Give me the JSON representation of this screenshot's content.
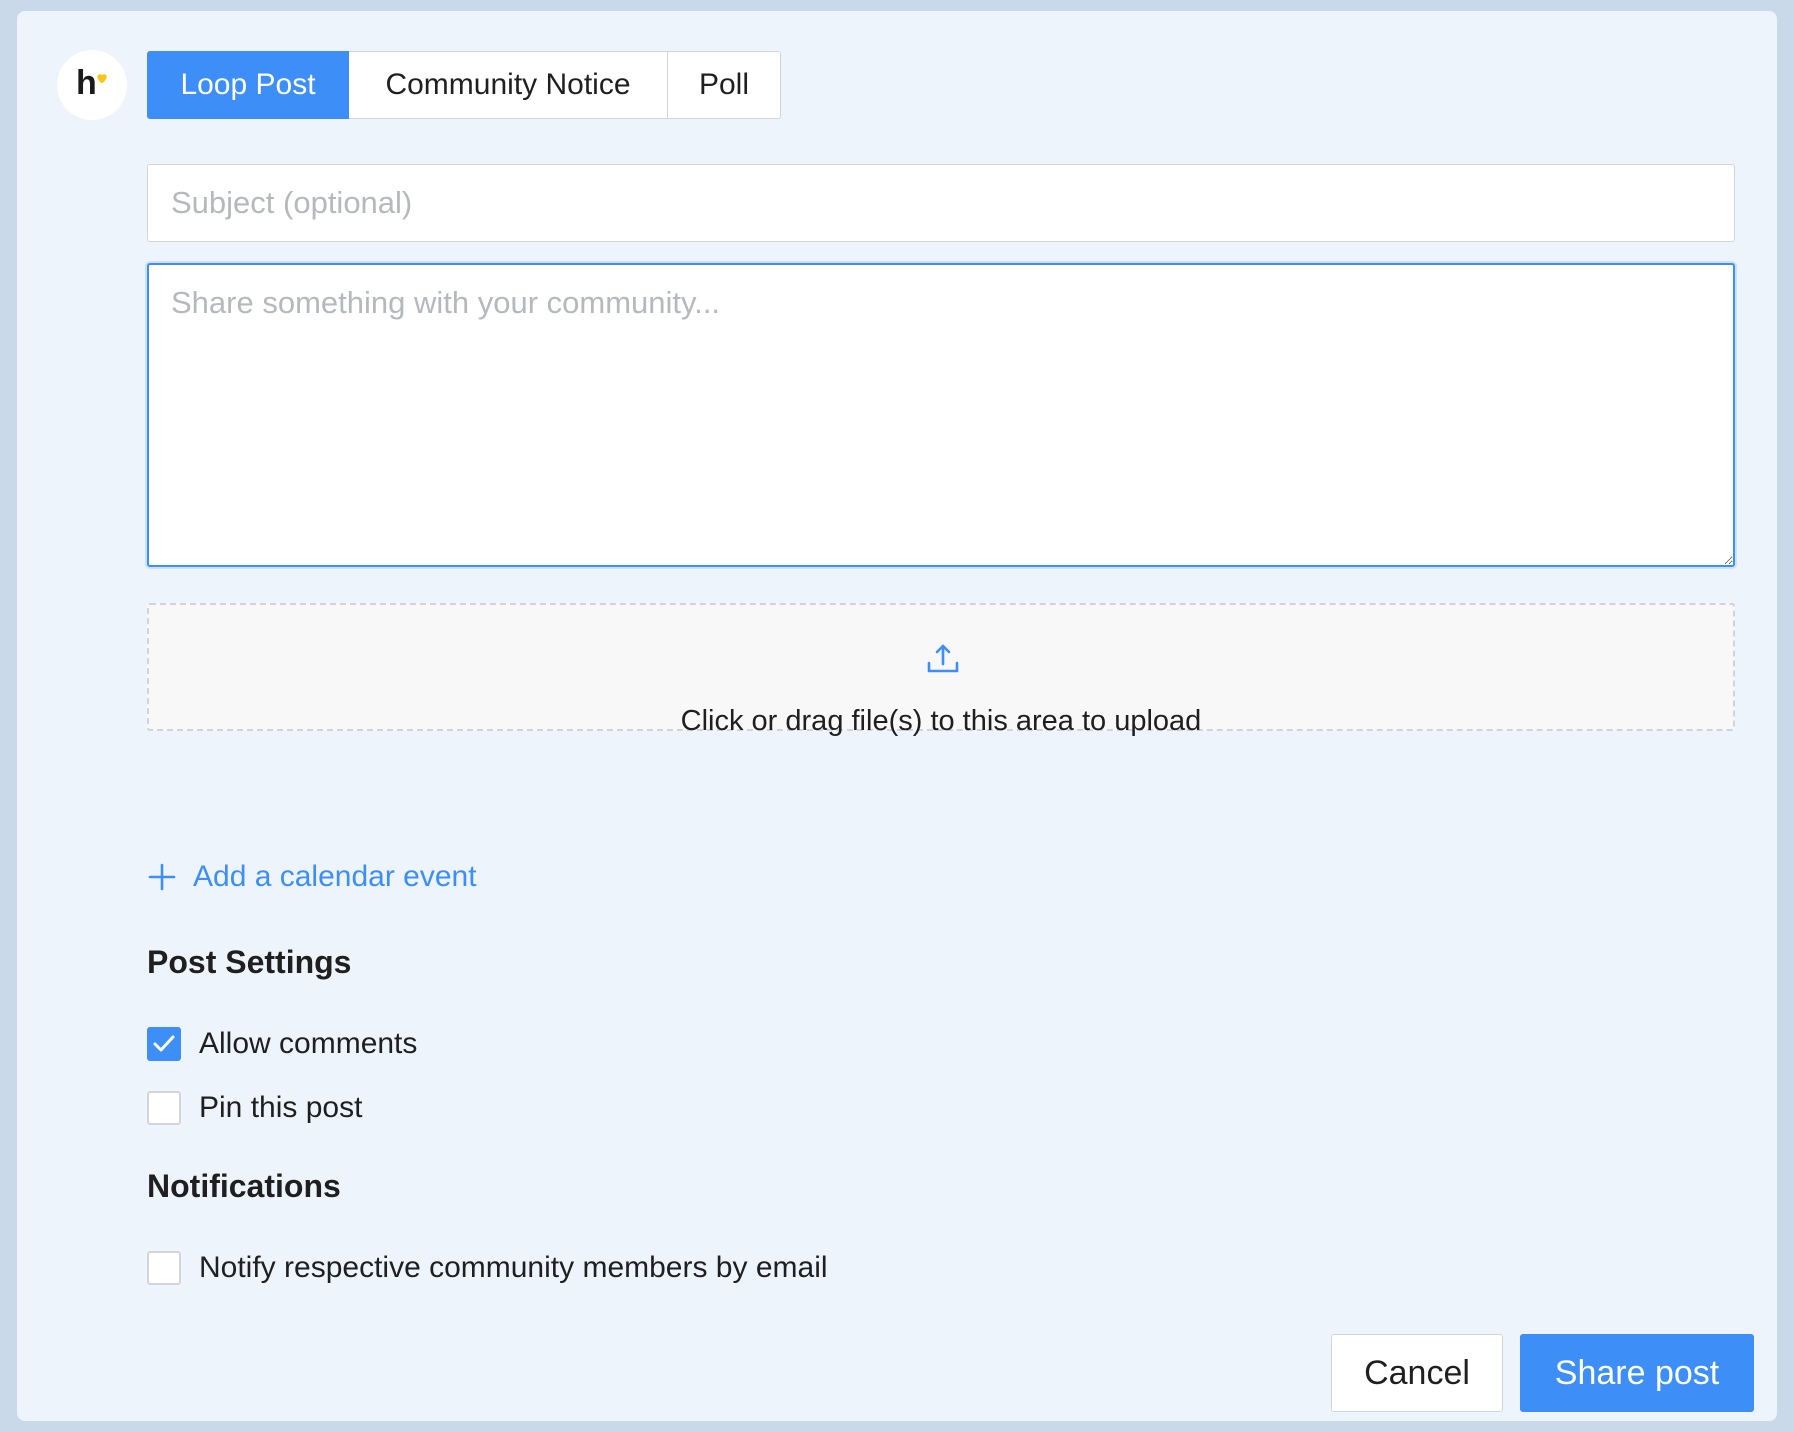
{
  "brand": {
    "logo_letter": "h",
    "logo_icon": "heart-icon",
    "logo_heart_color": "#f5c518"
  },
  "tabs": [
    {
      "label": "Loop Post",
      "active": true
    },
    {
      "label": "Community Notice",
      "active": false
    },
    {
      "label": "Poll",
      "active": false
    }
  ],
  "form": {
    "subject_placeholder": "Subject (optional)",
    "subject_value": "",
    "body_placeholder": "Share something with your community...",
    "body_value": ""
  },
  "upload": {
    "icon": "upload-icon",
    "text": "Click or drag file(s) to this area to upload"
  },
  "calendar": {
    "icon": "plus-icon",
    "label": "Add a calendar event"
  },
  "post_settings": {
    "heading": "Post Settings",
    "options": [
      {
        "label": "Allow comments",
        "checked": true
      },
      {
        "label": "Pin this post",
        "checked": false
      }
    ]
  },
  "notifications": {
    "heading": "Notifications",
    "options": [
      {
        "label": "Notify respective community members by email",
        "checked": false
      }
    ]
  },
  "actions": {
    "cancel_label": "Cancel",
    "share_label": "Share post"
  },
  "colors": {
    "accent": "#3e8ef7",
    "panel_background": "#edf4fb",
    "page_background": "#c9d9ea"
  }
}
